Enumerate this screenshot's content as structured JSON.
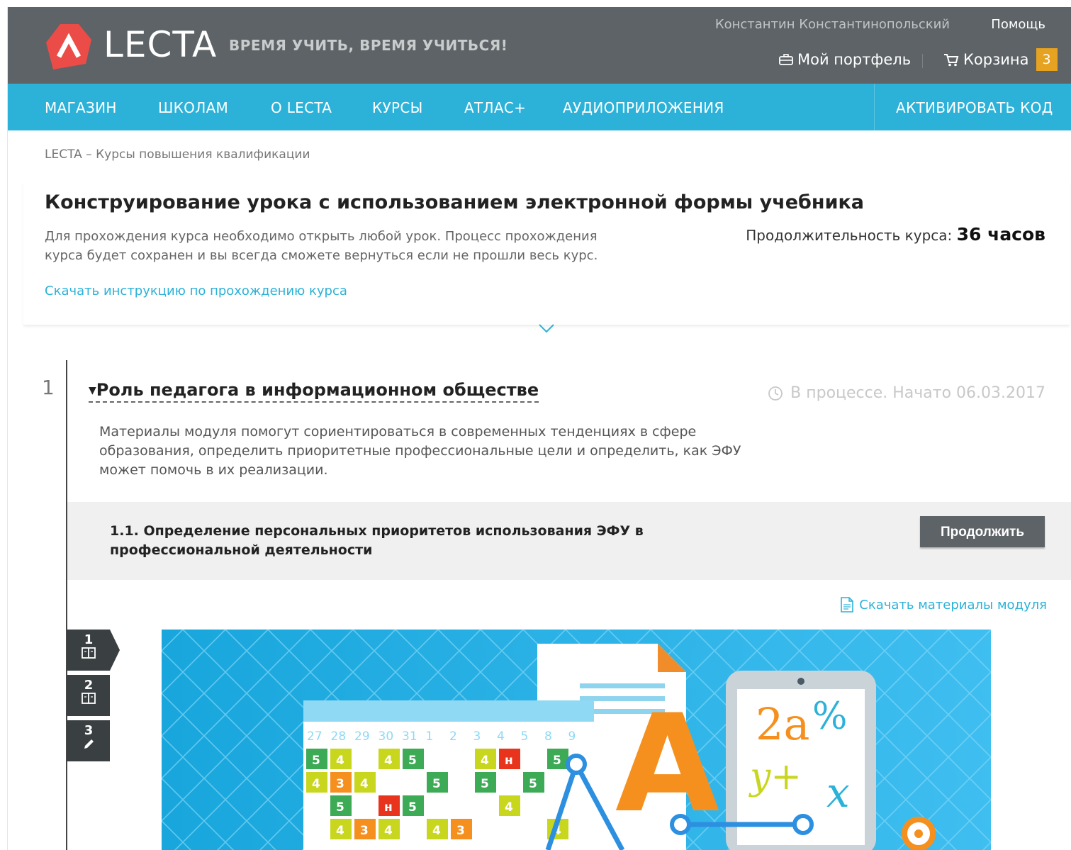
{
  "header": {
    "brand": "LECTA",
    "slogan": "ВРЕМЯ УЧИТЬ, ВРЕМЯ УЧИТЬСЯ!",
    "user_name": "Константин Константинопольский",
    "help": "Помощь",
    "portfolio": "Мой портфель",
    "cart": "Корзина",
    "cart_count": "3"
  },
  "nav": {
    "items": [
      "МАГАЗИН",
      "ШКОЛАМ",
      "О LECTA",
      "КУРСЫ",
      "АТЛАС+",
      "АУДИОПРИЛОЖЕНИЯ"
    ],
    "activate": "АКТИВИРОВАТЬ КОД"
  },
  "breadcrumb": "LECTA – Курсы повышения квалификации",
  "course": {
    "title": "Конструирование урока с использованием электронной формы учебника",
    "description": "Для прохождения курса необходимо открыть любой урок. Процесс прохождения курса будет сохранен и вы всегда сможете вернуться если не прошли весь курс.",
    "duration_label": "Продолжительность курса:",
    "duration_value": "36 часов",
    "instruction_link": "Скачать инструкцию по прохождению курса"
  },
  "module": {
    "number": "1",
    "title": "Роль педагога в информационном обществе",
    "status": "В процессе. Начато 06.03.2017",
    "description": "Материалы модуля помогут сориентироваться в современных тенденциях в сфере образования, определить приоритетные профессиональные цели и определить, как ЭФУ может помочь в их реализации.",
    "lesson": {
      "title": "1.1. Определение персональных приоритетов использования ЭФУ в профессиональной деятельности",
      "button": "Продолжить"
    },
    "download": "Скачать материалы модуля",
    "tabs": [
      {
        "num": "1",
        "icon": "book-icon"
      },
      {
        "num": "2",
        "icon": "book-icon"
      },
      {
        "num": "3",
        "icon": "pencil-icon"
      }
    ]
  },
  "illustration": {
    "calendar_days": [
      "27",
      "28",
      "29",
      "30",
      "31",
      "1",
      "2",
      "3",
      "4",
      "5",
      "8",
      "9"
    ],
    "tablet_text": [
      "2a",
      "%",
      "y+",
      "x"
    ],
    "big_letter": "A"
  },
  "colors": {
    "header_bg": "#5d6366",
    "nav_bg": "#2cb1d8",
    "accent_orange": "#e6a321",
    "logo_red": "#ec4c47"
  }
}
